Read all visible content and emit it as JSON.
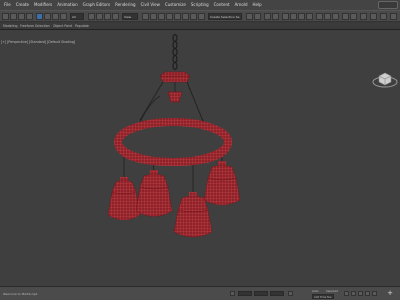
{
  "menubar": {
    "items": [
      {
        "label": "File"
      },
      {
        "label": "Create"
      },
      {
        "label": "Modifiers"
      },
      {
        "label": "Animation"
      },
      {
        "label": "Graph Editors"
      },
      {
        "label": "Rendering"
      },
      {
        "label": "Civil View"
      },
      {
        "label": "Customize"
      },
      {
        "label": "Scripting"
      },
      {
        "label": "Content"
      },
      {
        "label": "Arnold"
      },
      {
        "label": "Help"
      }
    ]
  },
  "toolbar": {
    "filter_value": "All",
    "view_value": "View",
    "selection_set_value": "Create Selection Se"
  },
  "ribbon": {
    "tabs": [
      {
        "label": "Modeling"
      },
      {
        "label": "Freeform"
      },
      {
        "label": "Selection"
      },
      {
        "label": "Object Paint"
      },
      {
        "label": "Populate"
      }
    ]
  },
  "viewport": {
    "label": "[+] [Perspective] [Standard] [Default Shading]",
    "accent_color": "#b8343c"
  },
  "statusbar": {
    "text": "Welcome to MAXScript.",
    "frame_info": "Auto",
    "selected_label": "Selected",
    "add_time_tag": "Add Time Tag"
  }
}
